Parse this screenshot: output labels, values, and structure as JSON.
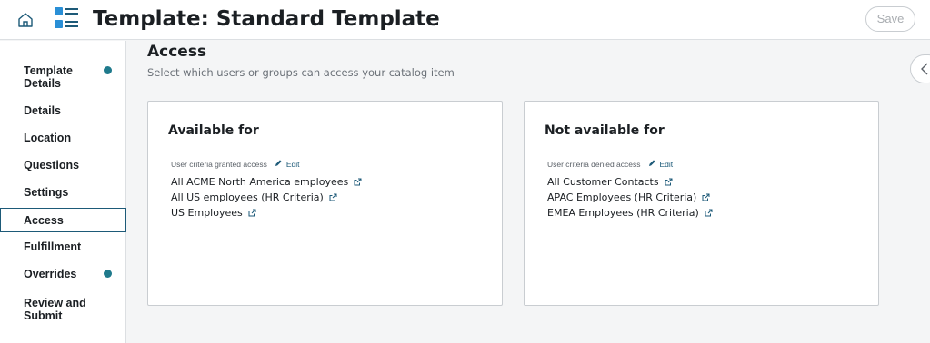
{
  "header": {
    "title": "Template: Standard Template",
    "save_label": "Save",
    "home_icon": "home-icon",
    "logo_icon": "catalog-builder-icon"
  },
  "colors": {
    "accent": "#1d5a78",
    "status_dot": "#1f7a8c",
    "logo_blue": "#2a8fd6"
  },
  "sidebar": {
    "items": [
      {
        "label": "Template Details",
        "status": "incomplete"
      },
      {
        "label": "Details"
      },
      {
        "label": "Location"
      },
      {
        "label": "Questions"
      },
      {
        "label": "Settings"
      },
      {
        "label": "Access",
        "active": true
      },
      {
        "label": "Fulfillment"
      },
      {
        "label": "Overrides",
        "status": "incomplete"
      },
      {
        "label": "Review and Submit"
      }
    ]
  },
  "main": {
    "title": "Access",
    "subtitle": "Select which users or groups can access your catalog item",
    "available": {
      "title": "Available for",
      "criteria_label": "User criteria granted access",
      "edit_label": "Edit",
      "items": [
        "All ACME North America employees",
        "All US employees (HR Criteria)",
        "US Employees"
      ]
    },
    "not_available": {
      "title": "Not available for",
      "criteria_label": "User criteria denied access",
      "edit_label": "Edit",
      "items": [
        "All Customer Contacts",
        "APAC Employees (HR Criteria)",
        "EMEA Employees (HR Criteria)"
      ]
    }
  },
  "icons": {
    "edit": "pencil-icon",
    "external_link": "external-link-icon",
    "collapse": "chevron-left-icon"
  }
}
